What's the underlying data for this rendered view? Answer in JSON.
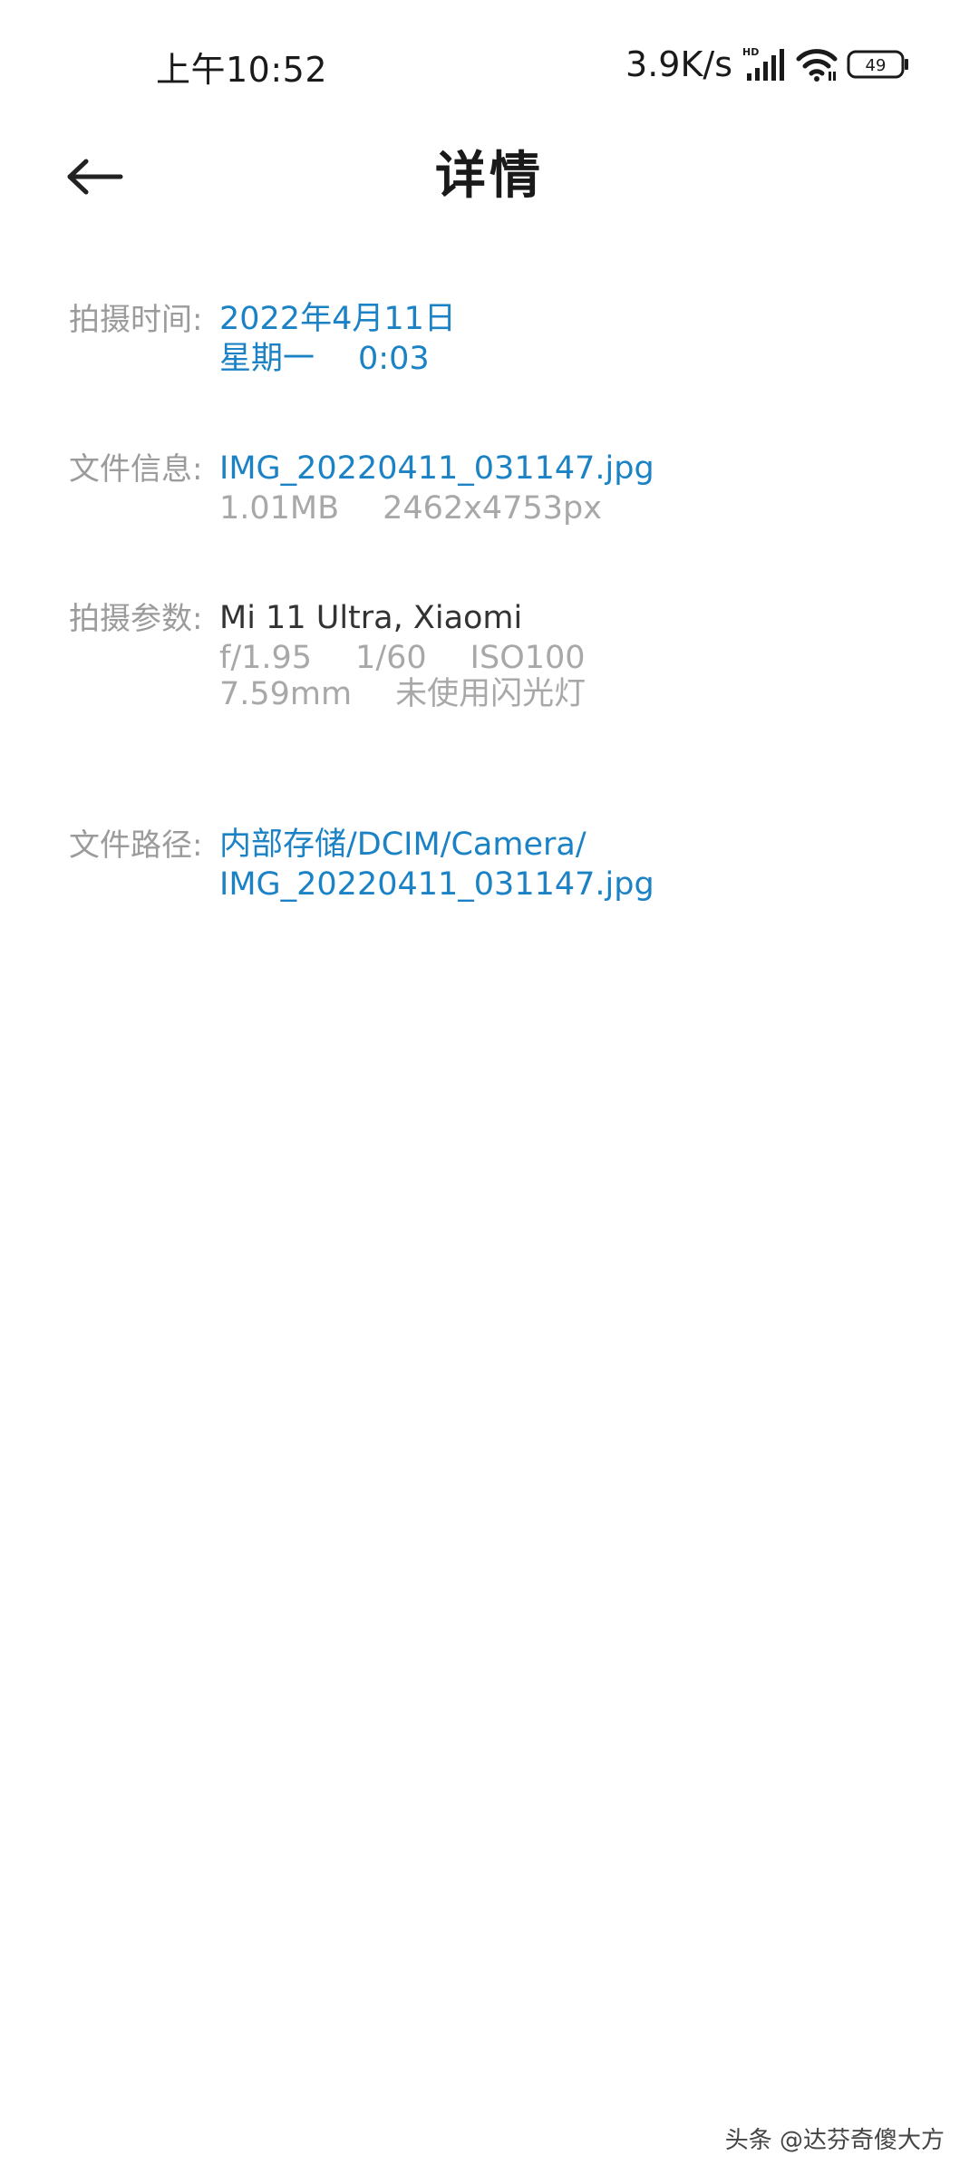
{
  "status_bar": {
    "time": "上午10:52",
    "net_speed": "3.9K/s",
    "network_badge": "HD",
    "battery_level": "49"
  },
  "header": {
    "title": "详情"
  },
  "details": {
    "capture_time": {
      "label": "拍摄时间:",
      "date": "2022年4月11日",
      "weekday": "星期一",
      "time": "0:03"
    },
    "file_info": {
      "label": "文件信息:",
      "filename": "IMG_20220411_031147.jpg",
      "size": "1.01MB",
      "dimensions": "2462x4753px"
    },
    "capture_params": {
      "label": "拍摄参数:",
      "device": "Mi 11 Ultra, Xiaomi",
      "aperture": "f/1.95",
      "shutter": "1/60",
      "iso": "ISO100",
      "focal_length": "7.59mm",
      "flash": "未使用闪光灯"
    },
    "file_path": {
      "label": "文件路径:",
      "path_line1": "内部存储/DCIM/Camera/",
      "path_line2": "IMG_20220411_031147.jpg"
    }
  },
  "watermark": {
    "text": "头条 @达芬奇傻大方"
  },
  "colors": {
    "link_blue": "#1a82c5",
    "label_gray": "#9b9b9b",
    "value_gray": "#a8a8a8"
  },
  "icons": [
    "back-arrow-icon",
    "signal-icon",
    "wifi-icon",
    "battery-icon"
  ]
}
